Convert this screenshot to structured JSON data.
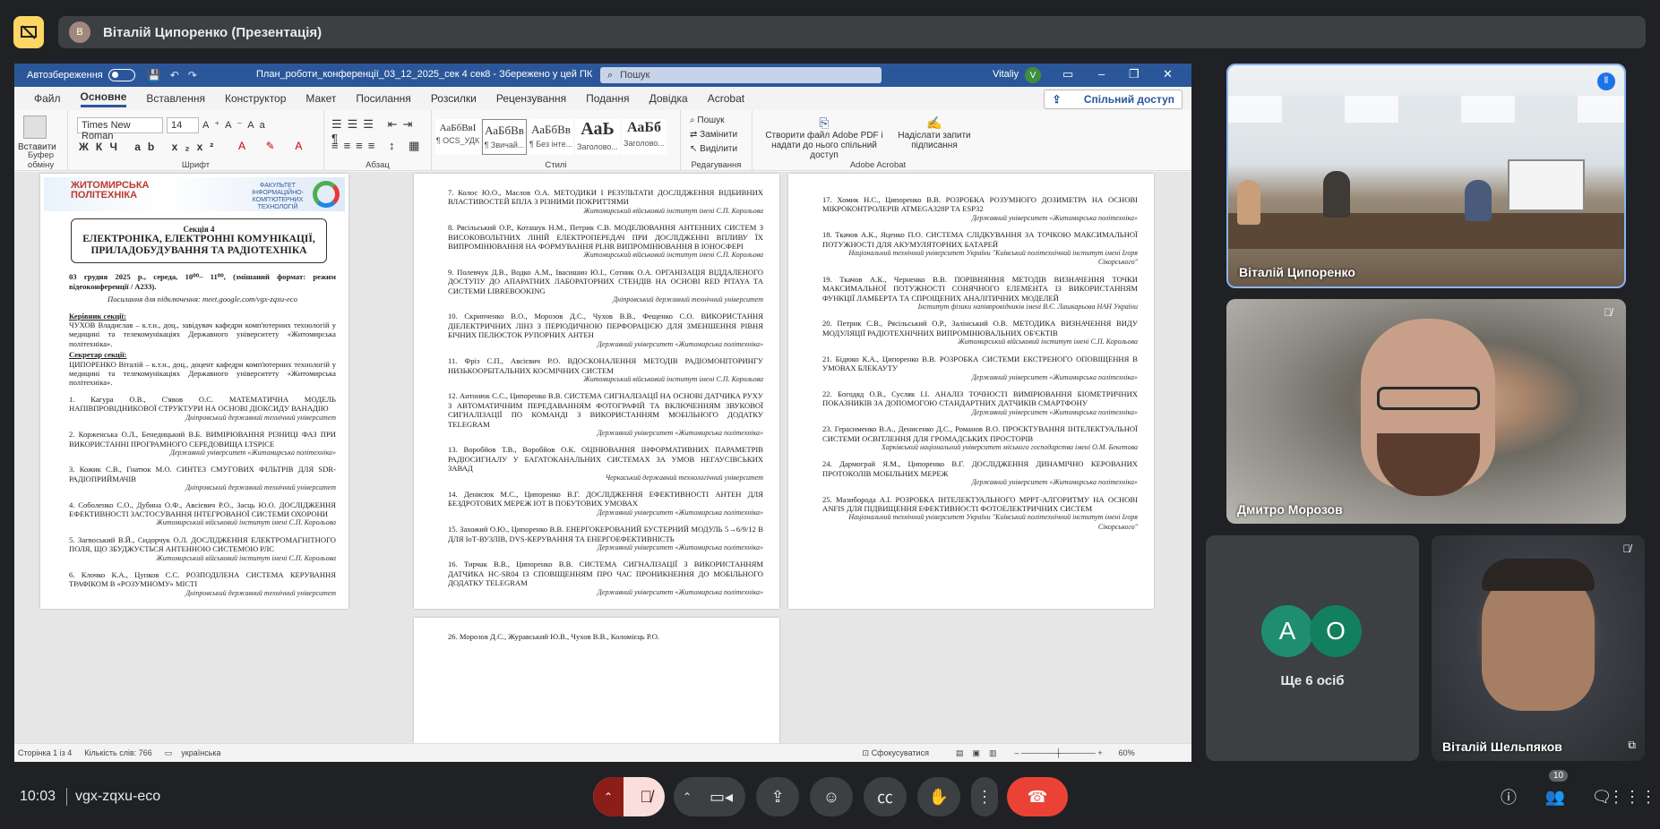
{
  "meeting": {
    "presenter_label": "Віталій Ципоренко (Презентація)",
    "stop_present_icon": "present-off-icon",
    "time": "10:03",
    "code": "vgx-zqxu-eco",
    "participants_count": "10"
  },
  "word": {
    "autosave_label": "Автозбереження",
    "doc_title": "План_роботи_конференції_03_12_2025_сек 4 сек8  -  Збережено у цей ПК",
    "search_placeholder": "Пошук",
    "user_name": "Vitaliy",
    "user_initial": "V",
    "menu": [
      "Файл",
      "Основне",
      "Вставлення",
      "Конструктор",
      "Макет",
      "Посилання",
      "Розсилки",
      "Рецензування",
      "Подання",
      "Довідка",
      "Acrobat"
    ],
    "share_label": "Спільний доступ",
    "ribbon": {
      "paste": "Вставити",
      "clipboard": "Буфер обміну",
      "font_name": "Times New Roman",
      "font_size": "14",
      "font_group": "Шрифт",
      "para_group": "Абзац",
      "styles_group": "Стилі",
      "styles": [
        {
          "sample": "АаБбВвІ",
          "name": "¶ OCS_УДК"
        },
        {
          "sample": "АаБбВв",
          "name": "¶ Звичай..."
        },
        {
          "sample": "АаБбВв",
          "name": "¶ Без інте..."
        },
        {
          "sample": "АаЬ",
          "name": "Заголово..."
        },
        {
          "sample": "АаБб",
          "name": "Заголово..."
        }
      ],
      "find": "Пошук",
      "replace": "Замінити",
      "select": "Виділити",
      "edit_group": "Редагування",
      "create_pdf": "Створити файл Adobe PDF і надати до нього спільний доступ",
      "request_sign": "Надіслати запити підписання",
      "acrobat_group": "Adobe Acrobat"
    },
    "status": {
      "page": "Сторінка 1 із 4",
      "words": "Кількість слів: 766",
      "lang": "українська",
      "focus": "Сфокусуватися",
      "zoom": "60%"
    }
  },
  "page1": {
    "logo_left": "ЖИТОМИРСЬКА ПОЛІТЕХНІКА",
    "logo_right": "ФАКУЛЬТЕТ ІНФОРМАЦІЙНО-КОМП'ЮТЕРНИХ ТЕХНОЛОГІЙ",
    "section": "Секція 4",
    "section_title": "ЕЛЕКТРОНІКА, ЕЛЕКТРОННІ КОМУНІКАЦІЇ, ПРИЛАДОБУДУВАННЯ ТА РАДІОТЕХНІКА",
    "date_line": "03 грудня 2025 р., середа, 10⁰⁰– 11⁰⁰, (змішаний формат: режим відеоконференції / А233).",
    "link_line": "Посилання для підключення: meet.google.com/vgx-zqxu-eco",
    "leaders_label": "Керівник секції:",
    "leader": "ЧУХОВ Владислав – к.т.н., доц., завідувач кафедри комп'ютерних технологій у медицині та телекомунікаціях Державного університету «Житомирська політехніка».",
    "secretary_label": "Секретар секції:",
    "secretary": "ЦИПОРЕНКО Віталій – к.т.н., доц., доцент кафедри комп'ютерних технологій у медицині та телекомунікаціях Державного університету «Житомирська політехніка».",
    "items": [
      {
        "t": "1. Кагура О.В., С'явов О.С. МАТЕМАТИЧНА МОДЕЛЬ НАПІВПРОВІДНИКОВОЇ СТРУКТУРИ НА ОСНОВІ ДІОКСИДУ ВАНАДІЮ",
        "a": "Дніпровський державний технічний університет"
      },
      {
        "t": "2. Корженська О.Л., Бенедицький В.Б. ВИМІРЮВАННЯ РІЗНИЦІ ФАЗ ПРИ ВИКОРИСТАННІ ПРОГРАМНОГО СЕРЕДОВИЩА LTSPICE",
        "a": "Державний університет «Житомирська політехніка»"
      },
      {
        "t": "3. Кожик С.В., Гнатюк М.О. СИНТЕЗ СМУГОВИХ ФІЛЬТРІВ ДЛЯ SDR-РАДІОПРИЙМАЧІВ",
        "a": "Дніпровський державний технічний університет"
      },
      {
        "t": "4. Соболенко С.О., Дубина О.Ф., Авсієвич Р.О., Засць Ю.О. ДОСЛІДЖЕННЯ ЕФЕКТИВНОСТІ ЗАСТОСУВАННЯ ІНТЕГРОВАНОЇ СИСТЕМИ ОХОРОНИ",
        "a": "Житомирський військовий інститут імені С.П. Корольова"
      },
      {
        "t": "5. Загвоський В.Й., Сидорчук О.Л. ДОСЛІДЖЕННЯ ЕЛЕКТРОМАГНІТНОГО ПОЛЯ, ЩО ЗБУДЖУЄТЬСЯ АНТЕННОЮ СИСТЕМОЮ РЛС",
        "a": "Житомирський військовий інститут імені С.П. Корольова"
      },
      {
        "t": "6. Клочко К.А., Цупков С.С. РОЗПОДІЛЕНА СИСТЕМА КЕРУВАННЯ ТРАФІКОМ В «РОЗУМНОМУ» МІСТІ",
        "a": "Дніпровський державний технічний університет"
      }
    ]
  },
  "page2": {
    "items": [
      {
        "t": "7. Колос Ю.О., Маслов О.А. МЕТОДИКИ І РЕЗУЛЬТАТИ ДОСЛІДЖЕННЯ ВІДБИВНИХ ВЛАСТИВОСТЕЙ БПЛА З РІЗНИМИ ПОКРИТТЯМИ",
        "a": "Житомирський військовий інститут імені С.П. Корольова"
      },
      {
        "t": "8. Рясільський О.Р., Коташук Н.М., Петрик С.В. МОДЕЛЮВАННЯ АНТЕННИХ СИСТЕМ З ВИСОКОВОЛЬТНИХ ЛІНІЙ ЕЛЕКТРОПЕРЕДАЧ ПРИ ДОСЛІДЖЕННІ ВПЛИВУ ЇХ ВИПРОМІНЮВАННЯ НА ФОРМУВАННЯ PLHR ВИПРОМІНЮВАННЯ В ІОНОСФЕРІ",
        "a": "Житомирський військовий інститут імені С.П. Корольова"
      },
      {
        "t": "9. Полевчук Д.В., Водко А.М., Івасишин Ю.І., Сотник О.А. ОРГАНІЗАЦІЯ ВІДДАЛЕНОГО ДОСТУПУ ДО АПАРАТНИХ ЛАБОРАТОРНИХ СТЕНДІВ НА ОСНОВІ RED PITAYA ТА СИСТЕМИ LIBREBOOKING",
        "a": "Дніпровський державний технічний університет"
      },
      {
        "t": "10. Скрипченко В.О., Морозов Д.С., Чухов В.В., Фещенко С.О. ВИКОРИСТАННЯ ДІЕЛЕКТРИЧНИХ ЛІНЗ З ПЕРІОДИЧНОЮ ПЕРФОРАЦІЄЮ ДЛЯ ЗМЕНШЕННЯ РІВНЯ БІЧНИХ ПЕЛЮСТОК РУПОРНИХ АНТЕН",
        "a": "Державний університет «Житомирська політехніка»"
      },
      {
        "t": "11. Фріз С.П., Авсієвич Р.О. ВДОСКОНАЛЕННЯ МЕТОДІВ РАДІОМОНІТОРИНГУ НИЗЬКООРБІТАЛЬНИХ КОСМІЧНИХ СИСТЕМ",
        "a": "Житомирський військовий інститут імені С.П. Корольова"
      },
      {
        "t": "12. Антонюк С.С., Ципоренко В.В. СИСТЕМА СИГНАЛІЗАЦІЇ НА ОСНОВІ ДАТЧИКА РУХУ З АВТОМАТИЧНИМ ПЕРЕДАВАННЯМ ФОТОГРАФІЙ ТА ВКЛЮЧЕННЯМ ЗВУКОВОЇ СИГНАЛІЗАЦІЇ ПО КОМАНДІ З ВИКОРИСТАННЯМ МОБІЛЬНОГО ДОДАТКУ TELEGRAM",
        "a": "Державний університет «Житомирська політехніка»"
      },
      {
        "t": "13. Воробйов Т.В., Воробйов О.К. ОЦІНЮВАННЯ ІНФОРМАТИВНИХ ПАРАМЕТРІВ РАДІОСИГНАЛУ У БАГАТОКАНАЛЬНИХ СИСТЕМАХ ЗА УМОВ НЕГАУСІВСЬКИХ ЗАВАД",
        "a": "Черкаський державний технологічний університет"
      },
      {
        "t": "14. Денисюк М.С., Ципоренко В.Г. ДОСЛІДЖЕННЯ ЕФЕКТИВНОСТІ АНТЕН ДЛЯ БЕЗДРОТОВИХ МЕРЕЖ ІОТ В ПОБУТОВИХ УМОВАХ",
        "a": "Державний університет «Житомирська політехніка»"
      },
      {
        "t": "15. Захожий О.Ю., Ципоренко В.В. ЕНЕРГОКЕРОВАНИЙ БУСТЕРНИЙ МОДУЛЬ 5→6/9/12 В ДЛЯ ІоТ-ВУЗЛІВ, DVS-КЕРУВАННЯ ТА ЕНЕРГОЕФЕКТИВНІСТЬ",
        "a": "Державний університет «Житомирська політехніка»"
      },
      {
        "t": "16. Тирчак В.В., Ципоренко В.В. СИСТЕМА СИГНАЛІЗАЦІЇ З ВИКОРИСТАННЯМ ДАТЧИКА HC-SR04 ІЗ СПОВІЩЕННЯМ ПРО ЧАС ПРОНИКНЕННЯ ДО МОБІЛЬНОГО ДОДАТКУ TELEGRAM",
        "a": "Державний університет «Житомирська політехніка»"
      }
    ]
  },
  "page3": {
    "items": [
      {
        "t": "17. Хомик Н.С., Ципоренко В.В. РОЗРОБКА РОЗУМНОГО ДОЗИМЕТРА НА ОСНОВІ МІКРОКОНТРОЛЕРІВ ATMEGA328P ТА ESP32",
        "a": "Державний університет «Житомирська політехніка»"
      },
      {
        "t": "18. Ткачов А.К., Яценко П.О. СИСТЕМА СЛІДКУВАННЯ ЗА ТОЧКОЮ МАКСИМАЛЬНОЇ ПОТУЖНОСТІ ДЛЯ АКУМУЛЯТОРНИХ БАТАРЕЙ",
        "a": "Національний технічний університет України \"Київський політехнічний інститут імені Ігоря Сікорського\""
      },
      {
        "t": "19. Ткачов А.К., Черненко В.В. ПОРІВНЯННЯ МЕТОДІВ ВИЗНАЧЕННЯ ТОЧКИ МАКСИМАЛЬНОЇ ПОТУЖНОСТІ СОНЯЧНОГО ЕЛЕМЕНТА ІЗ ВИКОРИСТАННЯМ ФУНКЦІЇ ЛАМБЕРТА ТА СПРОЩЕНИХ АНАЛІТИЧНИХ МОДЕЛЕЙ",
        "a": "Інститут фізики напівпровідників імені В.Є. Лашкарьова НАН України"
      },
      {
        "t": "20. Петрик С.В., Рясільський О.Р., Залінський О.В. МЕТОДИКА ВИЗНАЧЕННЯ ВИДУ МОДУЛЯЦІЇ РАДІОТЕХНІЧНИХ ВИПРОМІНЮВАЛЬНИХ ОБ'ЄКТІВ",
        "a": "Житомирський військовий інститут імені С.П. Корольова"
      },
      {
        "t": "21. Бідюко К.А., Ципоренко В.В. РОЗРОБКА СИСТЕМИ ЕКСТРЕНОГО ОПОВІЩЕННЯ В УМОВАХ БЛЕКАУТУ",
        "a": "Державний університет «Житомирська політехніка»"
      },
      {
        "t": "22. Богодяд О.В., Сусляк І.І. АНАЛІЗ ТОЧНОСТІ ВИМІРЮВАННЯ БІОМЕТРИЧНИХ ПОКАЗНИКІВ ЗА ДОПОМОГОЮ СТАНДАРТНИХ ДАТЧИКІВ СМАРТФОНУ",
        "a": "Державний університет «Житомирська політехніка»"
      },
      {
        "t": "23. Герасименко В.А., Денисенко Д.С., Романов В.О. ПРОЄКТУВАННЯ ІНТЕЛЕКТУАЛЬНОЇ СИСТЕМИ ОСВІТЛЕННЯ ДЛЯ ГРОМАДСЬКИХ ПРОСТОРІВ",
        "a": "Харківський національний університет міського господарства імені О.М. Бекетова"
      },
      {
        "t": "24. Дармограй Я.М., Ципоренко В.Г. ДОСЛІДЖЕННЯ ДИНАМІЧНО КЕРОВАНИХ ПРОТОКОЛІВ МОБІЛЬНИХ МЕРЕЖ",
        "a": "Державний університет «Житомирська політехніка»"
      },
      {
        "t": "25. Мазибородa А.І. РОЗРОБКА ІНТЕЛЕКТУАЛЬНОГО МРРТ-АЛГОРИТМУ НА ОСНОВІ ANFIS ДЛЯ ПІДВИЩЕННЯ ЕФЕКТИВНОСТІ ФОТОЕЛЕКТРИЧНИХ СИСТЕМ",
        "a": "Національний технічний університет України \"Київський політехнічний інститут імені Ігоря Сікорського\""
      }
    ]
  },
  "page4": {
    "first_line": "26. Морозов Д.С., Журавський Ю.В., Чухов В.В., Коломієць Р.О."
  },
  "tiles": {
    "t1_name": "Віталій Ципоренко",
    "t2_name": "Дмитро Морозов",
    "others_label": "Ще 6 осіб",
    "others_initials": [
      "А",
      "О"
    ],
    "t4_name": "Віталій Шельпяков"
  },
  "colors": {
    "accent": "#2b579a",
    "end_call": "#ea4335",
    "muted_btn": "#f9dedc"
  }
}
